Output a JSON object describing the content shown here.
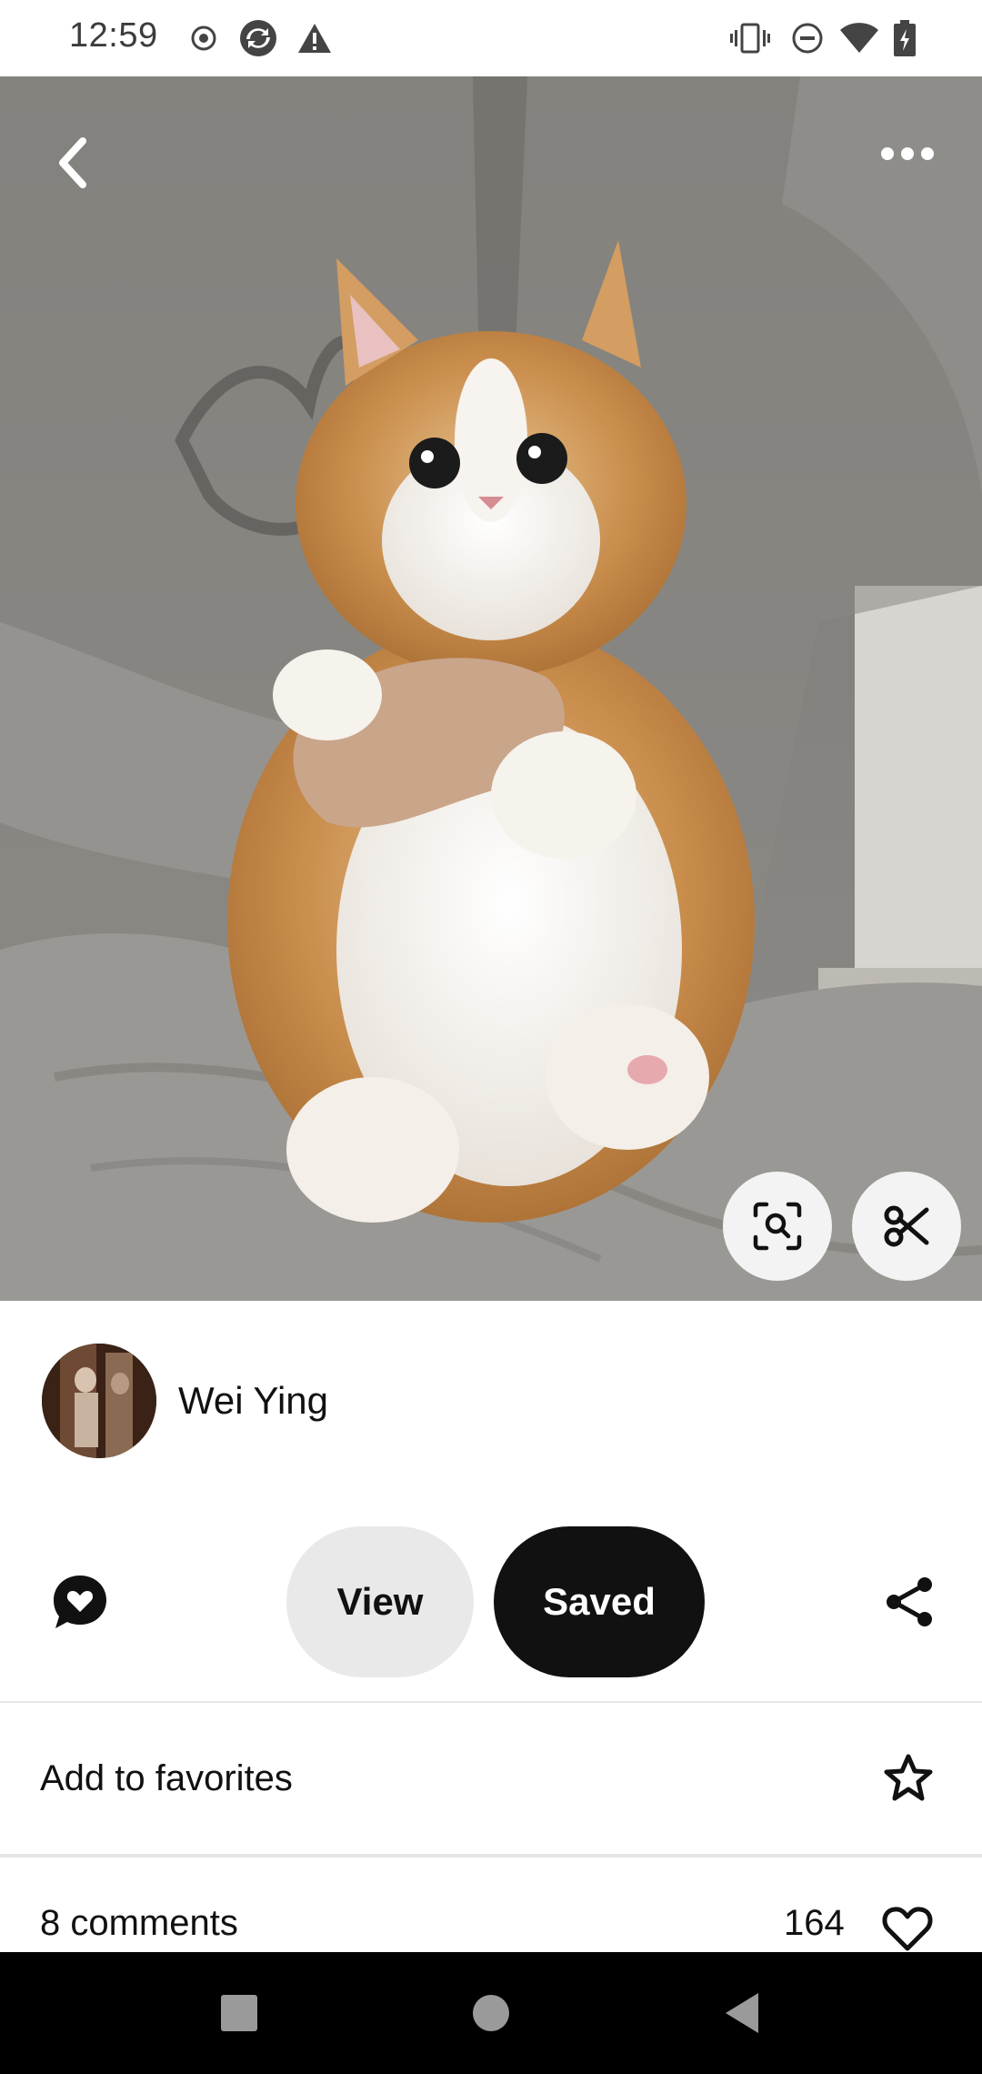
{
  "status_bar": {
    "time": "12:59",
    "left_icons": [
      "record-icon",
      "sync-icon",
      "warning-icon"
    ],
    "right_icons": [
      "vibrate-icon",
      "do-not-disturb-icon",
      "wifi-icon",
      "battery-charging-icon"
    ]
  },
  "pin": {
    "image_icons": [
      "back-chevron-icon",
      "more-options-icon",
      "visual-search-icon",
      "scissors-icon"
    ]
  },
  "creator": {
    "name": "Wei Ying"
  },
  "actions": {
    "view_label": "View",
    "saved_label": "Saved"
  },
  "favorites": {
    "label": "Add to favorites"
  },
  "engagement": {
    "comments_label": "8 comments",
    "likes_count": "164"
  },
  "navigation": {
    "buttons": [
      "recents-square-icon",
      "home-circle-icon",
      "back-triangle-icon"
    ]
  },
  "colors": {
    "accent_dark": "#111111",
    "pill_light": "#e9e9e9",
    "nav_bar": "#000000"
  }
}
